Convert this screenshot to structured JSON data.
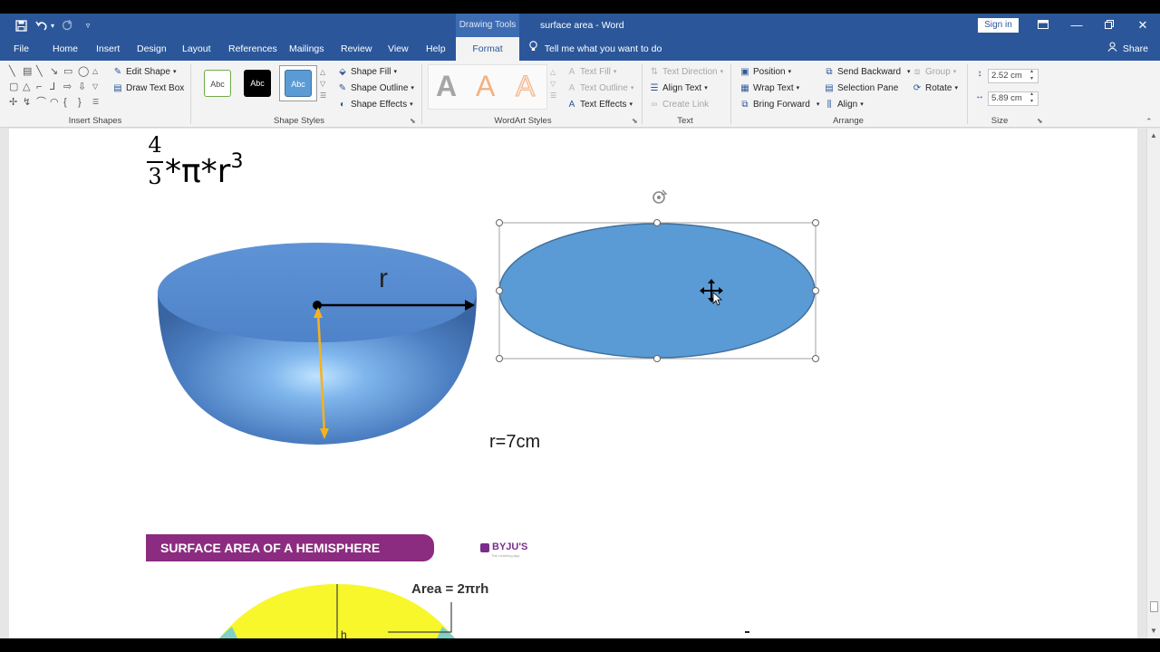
{
  "title_bar": {
    "context_tab": "Drawing Tools",
    "document_title": "surface area  -  Word",
    "sign_in": "Sign in",
    "qat_icons": [
      "save-icon",
      "undo-icon",
      "redo-icon",
      "customize-icon"
    ],
    "window_icons": [
      "ribbon-display-icon",
      "minimize-icon",
      "restore-icon",
      "close-icon"
    ]
  },
  "tabs": [
    {
      "label": "File"
    },
    {
      "label": "Home"
    },
    {
      "label": "Insert"
    },
    {
      "label": "Design"
    },
    {
      "label": "Layout"
    },
    {
      "label": "References"
    },
    {
      "label": "Mailings"
    },
    {
      "label": "Review"
    },
    {
      "label": "View"
    },
    {
      "label": "Help"
    },
    {
      "label": "Format",
      "active": true
    }
  ],
  "tell_me": "Tell me what you want to do",
  "share": "Share",
  "ribbon": {
    "insert_shapes": {
      "label": "Insert Shapes",
      "edit_shape": "Edit Shape",
      "draw_text_box": "Draw Text Box"
    },
    "shape_styles": {
      "label": "Shape Styles",
      "styles": [
        "Abc",
        "Abc",
        "Abc"
      ],
      "shape_fill": "Shape Fill",
      "shape_outline": "Shape Outline",
      "shape_effects": "Shape Effects"
    },
    "wordart_styles": {
      "label": "WordArt Styles",
      "letters": [
        "A",
        "A",
        "A"
      ],
      "text_fill": "Text Fill",
      "text_outline": "Text Outline",
      "text_effects": "Text Effects"
    },
    "text": {
      "label": "Text",
      "text_direction": "Text Direction",
      "align_text": "Align Text",
      "create_link": "Create Link"
    },
    "arrange": {
      "label": "Arrange",
      "position": "Position",
      "wrap_text": "Wrap Text",
      "bring_forward": "Bring Forward",
      "send_backward": "Send Backward",
      "selection_pane": "Selection Pane",
      "align": "Align",
      "group": "Group",
      "rotate": "Rotate"
    },
    "size": {
      "label": "Size",
      "height": "2.52 cm",
      "width": "5.89 cm"
    }
  },
  "colors": {
    "word_blue": "#2b579a",
    "ellipse_fill": "#5b9bd5",
    "ellipse_stroke": "#41719c",
    "banner": "#8b2c80"
  },
  "document": {
    "formula": {
      "numerator": "4",
      "denominator": "3",
      "expression": "*π*r",
      "exponent": "3"
    },
    "hemisphere_label": "r",
    "radius_text": "r=7cm",
    "banner_text": "SURFACE AREA OF A HEMISPHERE",
    "logo_text": "BYJU'S",
    "logo_sub": "The Learning App",
    "area_formula": "Area = 2πrh",
    "cutoff_label": "h"
  }
}
